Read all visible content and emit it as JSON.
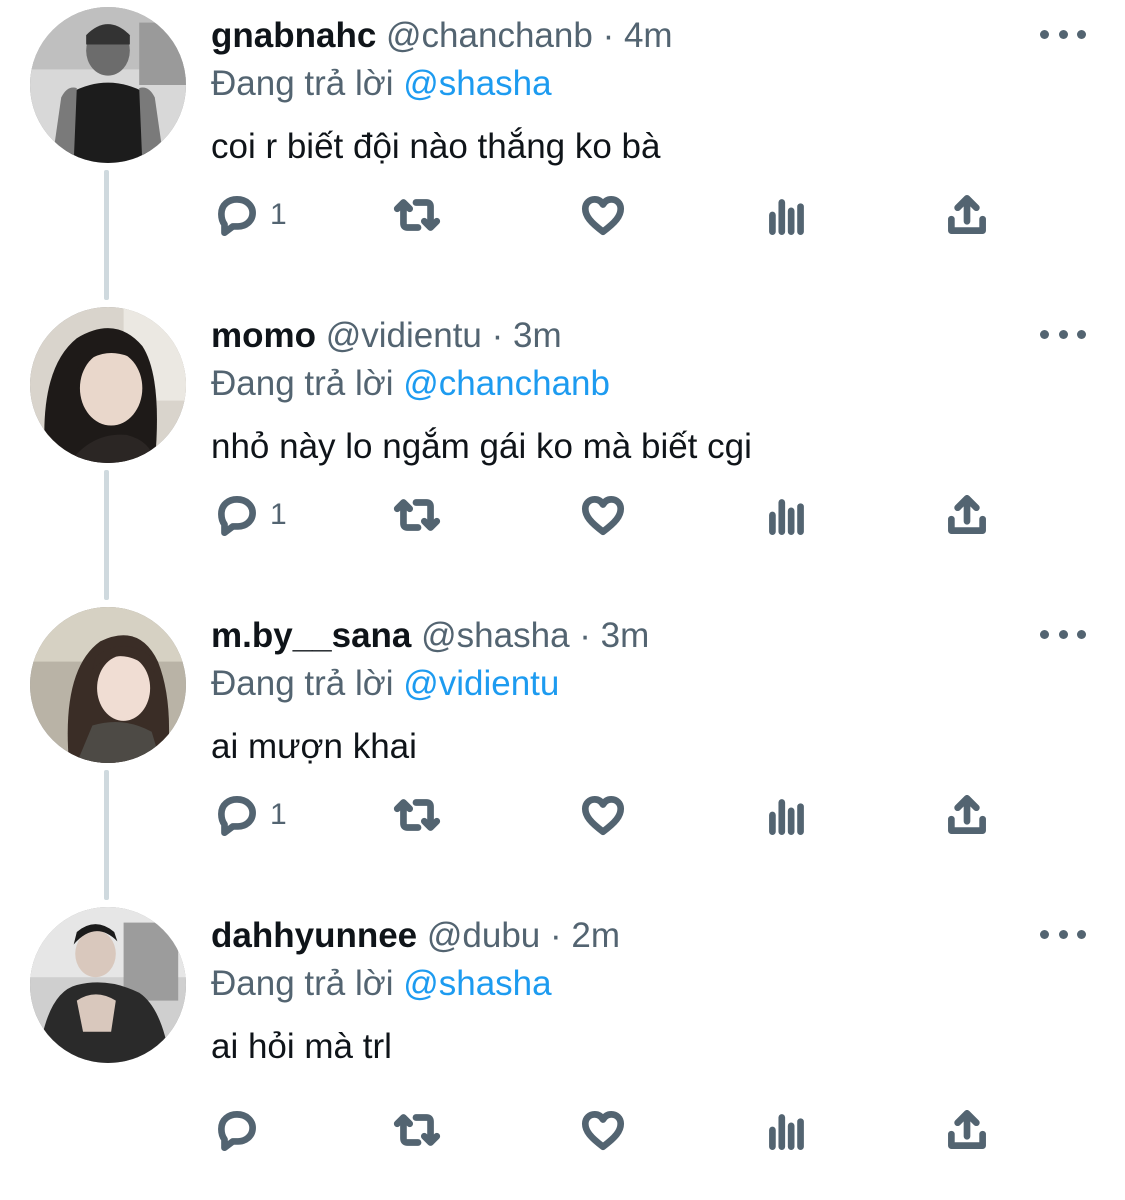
{
  "tweets": [
    {
      "display_name": "gnabnahc",
      "handle": "@chanchanb",
      "separator": "·",
      "time": "4m",
      "reply_prefix": "Đang trả lời",
      "reply_mention": "@shasha",
      "text": "coi r biết đội nào thắng ko bà",
      "reply_count": "1"
    },
    {
      "display_name": "momo",
      "handle": "@vidientu",
      "separator": "·",
      "time": "3m",
      "reply_prefix": "Đang trả lời",
      "reply_mention": "@chanchanb",
      "text": "nhỏ này lo ngắm gái ko mà biết cgi",
      "reply_count": "1"
    },
    {
      "display_name": "m.by__sana",
      "handle": "@shasha",
      "separator": "·",
      "time": "3m",
      "reply_prefix": "Đang trả lời",
      "reply_mention": "@vidientu",
      "text": "ai mượn khai",
      "reply_count": "1"
    },
    {
      "display_name": "dahhyunnee",
      "handle": "@dubu",
      "separator": "·",
      "time": "2m",
      "reply_prefix": "Đang trả lời",
      "reply_mention": "@shasha",
      "text": "ai hỏi mà trl",
      "reply_count": ""
    }
  ],
  "icons": {
    "reply": "reply-icon",
    "retweet": "retweet-icon",
    "like": "like-icon",
    "views": "views-icon",
    "share": "share-icon",
    "more": "more-icon"
  },
  "colors": {
    "mention": "#1d9bf0",
    "secondary_text": "#536471",
    "thread_line": "#cfd9de"
  }
}
